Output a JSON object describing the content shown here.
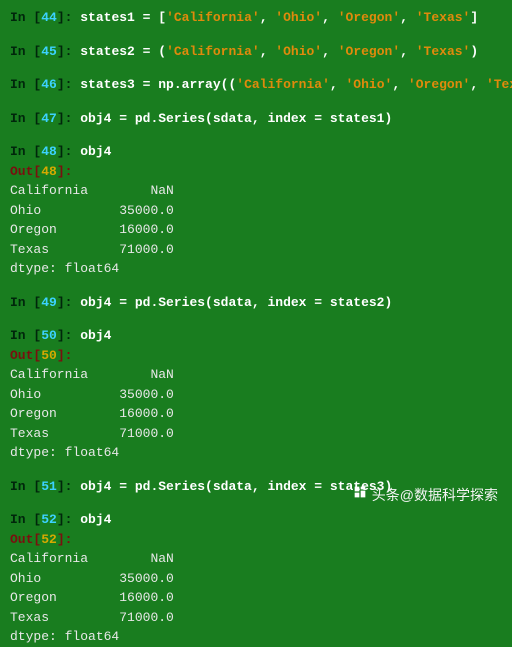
{
  "cells": [
    {
      "num": "44",
      "code_pre": "states1 = [",
      "strings": [
        "California",
        "Ohio",
        "Oregon",
        "Texas"
      ],
      "brackets": [
        "[",
        "]"
      ],
      "code_post": ""
    },
    {
      "num": "45",
      "code_pre": "states2 = (",
      "strings": [
        "California",
        "Ohio",
        "Oregon",
        "Texas"
      ],
      "brackets": [
        "(",
        ")"
      ],
      "code_post": ""
    },
    {
      "num": "46",
      "code_pre": "states3 = np.array((",
      "strings": [
        "California",
        "Ohio",
        "Oregon",
        "Texas"
      ],
      "brackets": [
        "(",
        "))"
      ],
      "code_post": ""
    },
    {
      "num": "47",
      "code_full": "obj4 = pd.Series(sdata, index = states1)"
    }
  ],
  "display1": {
    "in_num": "48",
    "in_code": "obj4",
    "out_num": "48",
    "rows": [
      {
        "label": "California",
        "value": "NaN"
      },
      {
        "label": "Ohio",
        "value": "35000.0"
      },
      {
        "label": "Oregon",
        "value": "16000.0"
      },
      {
        "label": "Texas",
        "value": "71000.0"
      }
    ],
    "dtype": "dtype: float64"
  },
  "mid1": {
    "num": "49",
    "code": "obj4 = pd.Series(sdata, index = states2)"
  },
  "display2": {
    "in_num": "50",
    "in_code": "obj4",
    "out_num": "50",
    "rows": [
      {
        "label": "California",
        "value": "NaN"
      },
      {
        "label": "Ohio",
        "value": "35000.0"
      },
      {
        "label": "Oregon",
        "value": "16000.0"
      },
      {
        "label": "Texas",
        "value": "71000.0"
      }
    ],
    "dtype": "dtype: float64"
  },
  "mid2": {
    "num": "51",
    "code": "obj4 = pd.Series(sdata, index = states3)"
  },
  "display3": {
    "in_num": "52",
    "in_code": "obj4",
    "out_num": "52",
    "rows": [
      {
        "label": "California",
        "value": "NaN"
      },
      {
        "label": "Ohio",
        "value": "35000.0"
      },
      {
        "label": "Oregon",
        "value": "16000.0"
      },
      {
        "label": "Texas",
        "value": "71000.0"
      }
    ],
    "dtype": "dtype: float64"
  },
  "watermark": "头条@数据科学探索"
}
